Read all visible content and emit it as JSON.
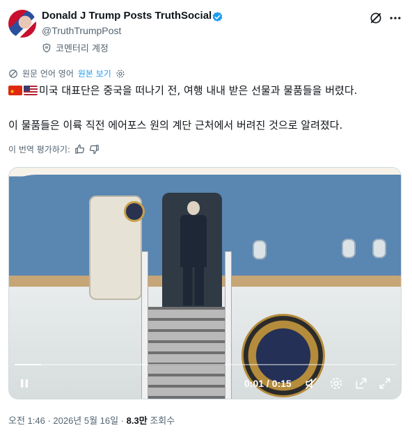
{
  "author": {
    "display_name": "Donald J Trump Posts TruthSocial",
    "handle": "@TruthTrumpPost",
    "account_label": "코멘터리 계정"
  },
  "translation": {
    "notice": "원문 언어 영어",
    "show_original": "원본 보기"
  },
  "tweet": {
    "line1": "미국 대표단은 중국을 떠나기 전, 여행 내내 받은 선물과 물품들을 버렸다.",
    "line2": "이 물품들은 이륙 직전 에어포스 원의 계단 근처에서 버려진 것으로 알려졌다."
  },
  "rate_translation": "이 번역 평가하기:",
  "video": {
    "time": "0:01 / 0:15",
    "progress": 0.07
  },
  "meta": {
    "timestamp": "오전 1:46 · 2026년 5월 16일 · ",
    "views_count": "8.3만",
    "views_label": " 조회수"
  },
  "colors": {
    "accent": "#1d9bf0",
    "secondary_text": "#536471"
  }
}
